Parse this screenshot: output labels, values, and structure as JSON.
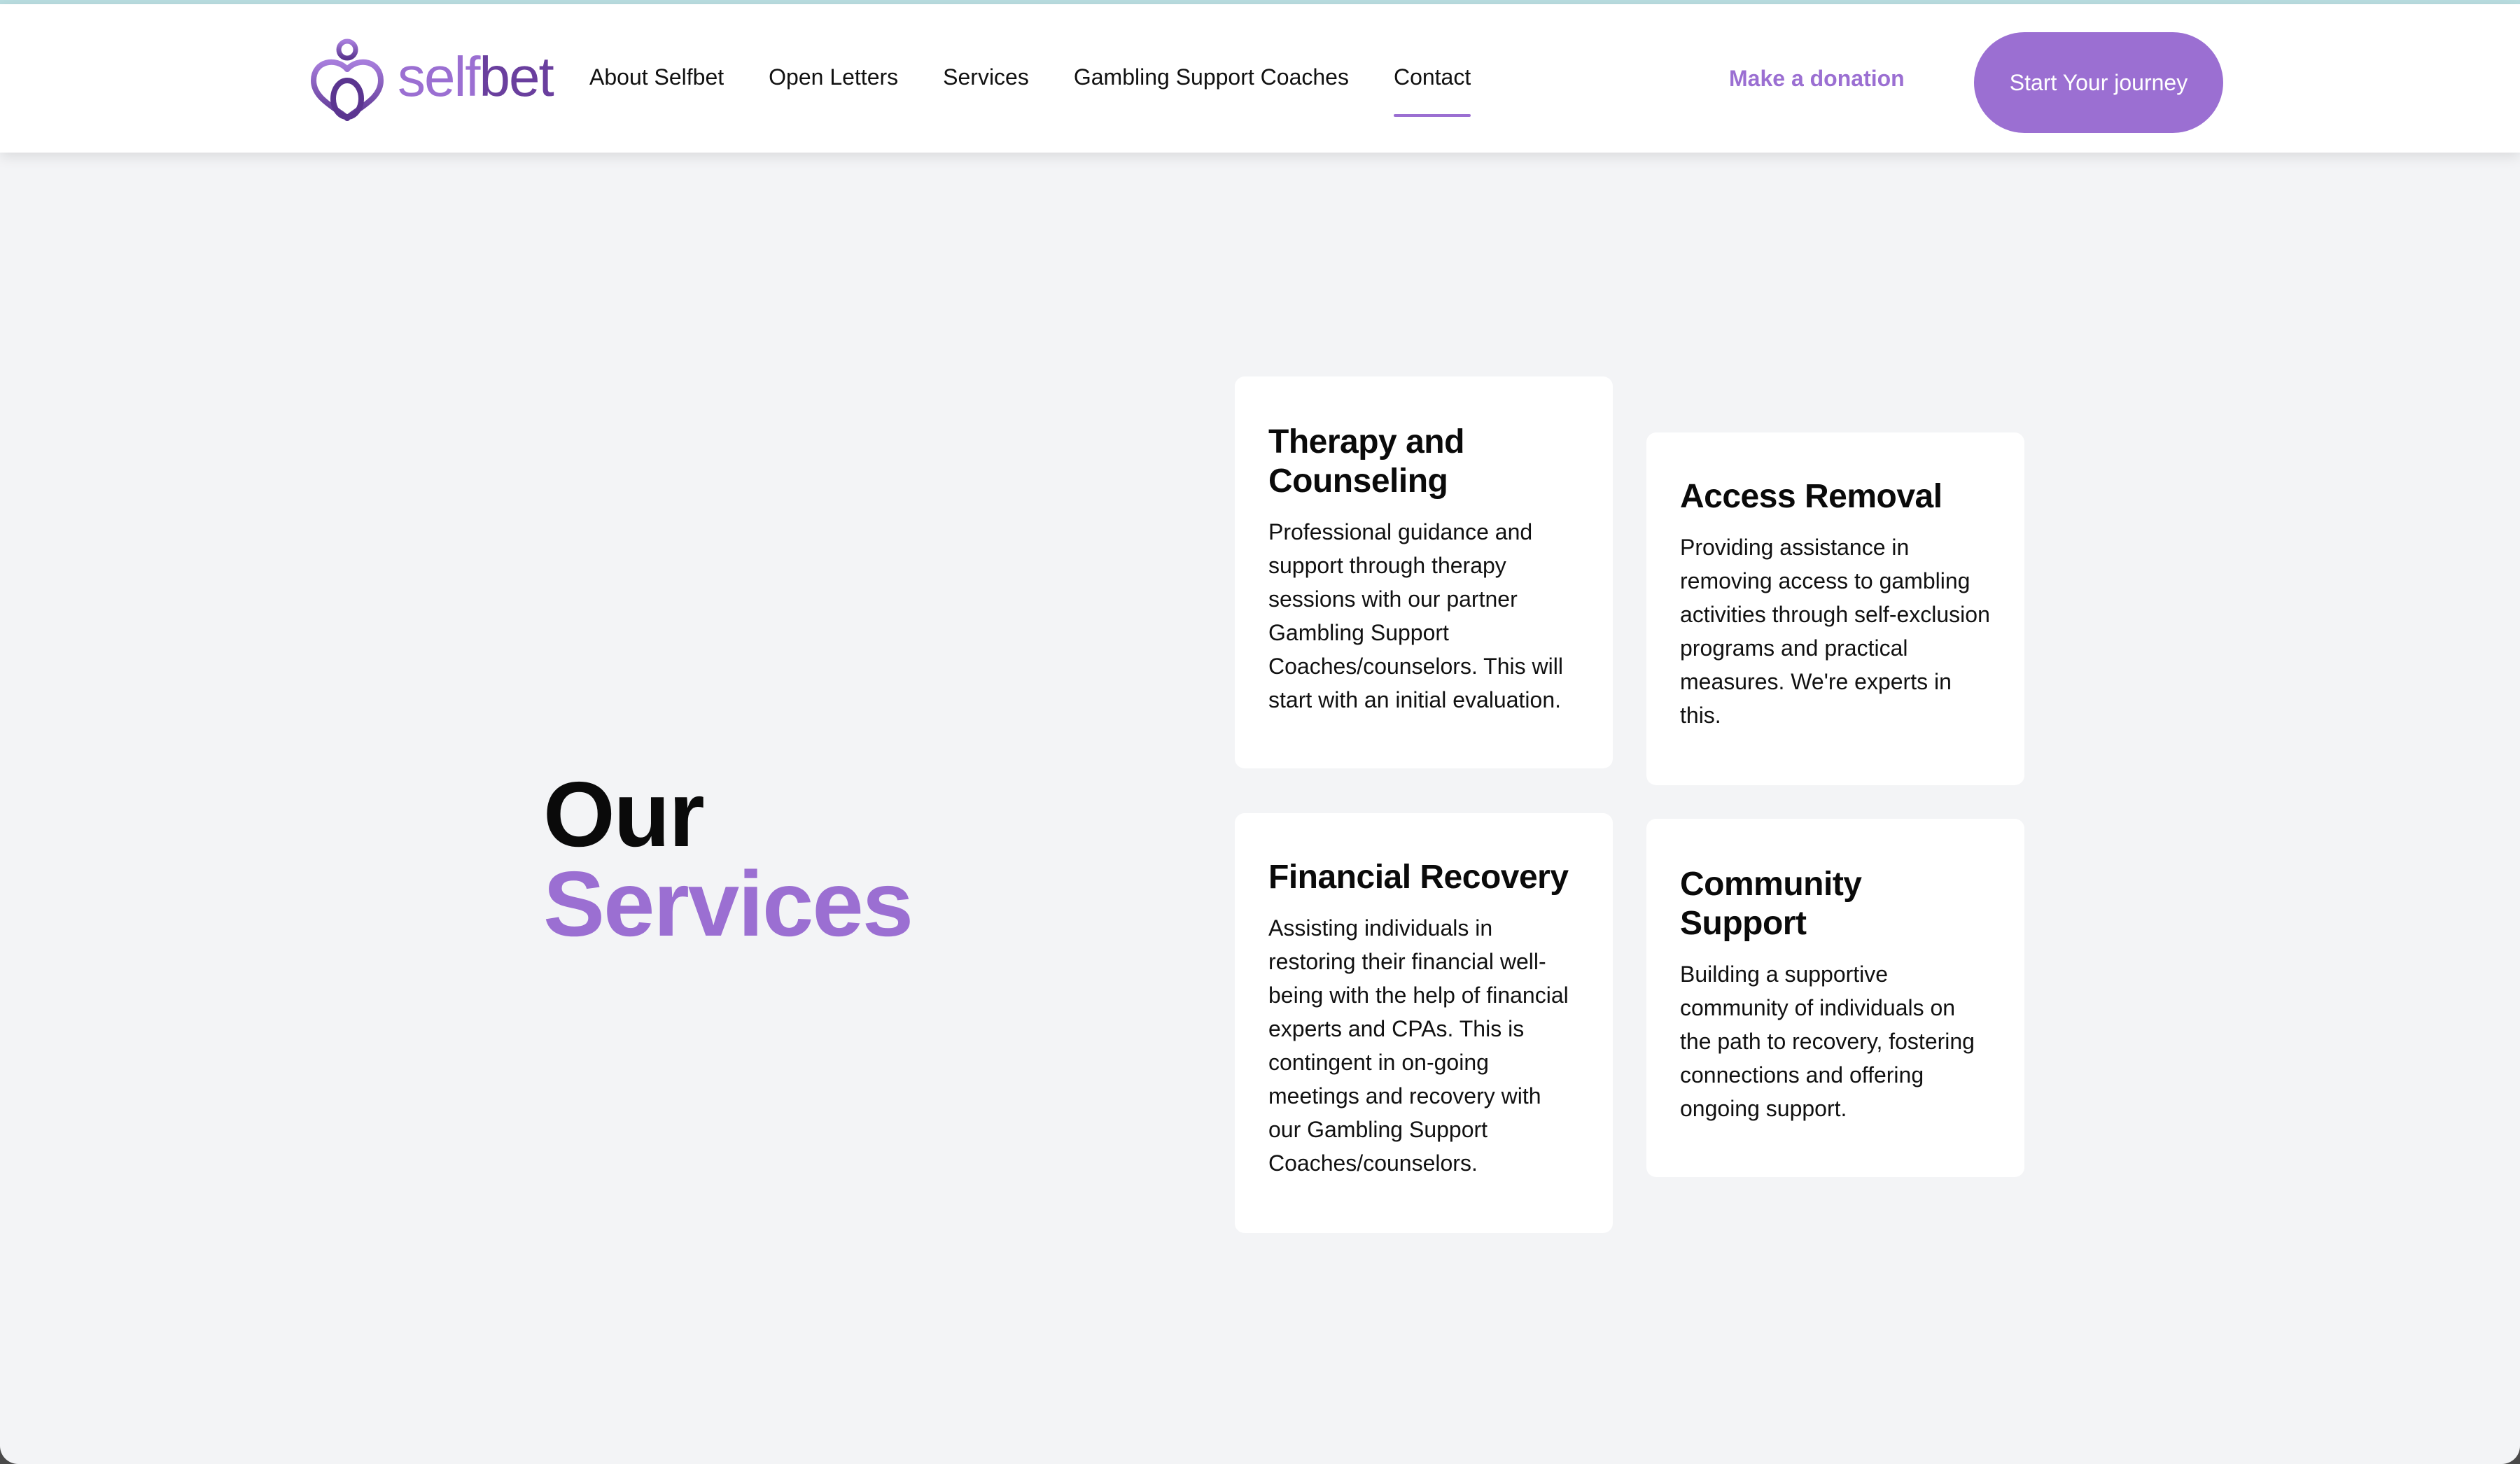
{
  "header": {
    "logo": {
      "text_part1": "self",
      "text_part2": "bet",
      "icon": "selfbet-heart-logo-icon"
    },
    "nav": [
      {
        "label": "About Selfbet",
        "active": false
      },
      {
        "label": "Open Letters",
        "active": false
      },
      {
        "label": "Services",
        "active": false
      },
      {
        "label": "Gambling Support Coaches",
        "active": false
      },
      {
        "label": "Contact",
        "active": true
      }
    ],
    "donate_label": "Make a donation",
    "cta_label": "Start Your journey"
  },
  "hero": {
    "title_line1": "Our",
    "title_line2": "Services"
  },
  "services": [
    {
      "title": "Therapy and Counseling",
      "text": "Professional guidance and support through therapy sessions with our partner Gambling Support Coaches/counselors. This will start with an initial evaluation."
    },
    {
      "title": "Access Removal",
      "text": "Providing assistance in removing access to gambling activities through self-exclusion programs and practical measures. We're experts in this."
    },
    {
      "title": "Financial Recovery",
      "text": "Assisting individuals in restoring their financial well-being with the help of financial experts and CPAs. This is contingent in on-going meetings and recovery with our Gambling Support Coaches/counselors."
    },
    {
      "title": "Community Support",
      "text": "Building a supportive community of individuals on the path to recovery, fostering connections and offering ongoing support."
    }
  ],
  "colors": {
    "accent": "#9b6fd2",
    "accent_dark": "#6a3f9e",
    "page_bg": "#f3f4f6",
    "card_bg": "#ffffff"
  }
}
